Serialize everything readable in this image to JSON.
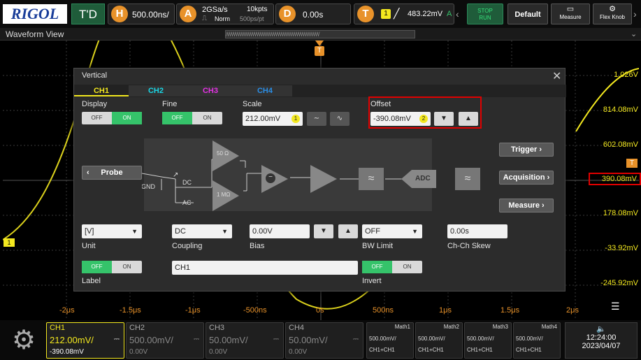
{
  "brand": "RIGOL",
  "top": {
    "mode": "T'D",
    "h_letter": "H",
    "h_value": "500.00ns/",
    "a_letter": "A",
    "sample_rate": "2GSa/s",
    "memory": "10kpts",
    "acq_mode": "Norm",
    "sample_interval": "500ps/pt",
    "d_letter": "D",
    "delay": "0.00s",
    "t_letter": "T",
    "trig_source": "1",
    "trig_level": "483.22mV",
    "trig_mode": "A",
    "stop_run": "STOP RUN",
    "stop_label": "STOP",
    "run_label": "RUN",
    "default_label": "Default",
    "measure_label": "Measure",
    "flexknob_label": "Flex Knob"
  },
  "waveform_title": "Waveform View",
  "y_labels": [
    "1.026V",
    "814.08mV",
    "602.08mV",
    "390.08mV",
    "178.08mV",
    "-33.92mV",
    "-245.92mV"
  ],
  "x_labels": [
    "-2μs",
    "-1.5μs",
    "-1μs",
    "-500ns",
    "0s",
    "500ns",
    "1μs",
    "1.5μs",
    "2μs"
  ],
  "markers": {
    "trigger_top": "T",
    "trigger_right": "T",
    "ch1": "1"
  },
  "dialog": {
    "title": "Vertical",
    "tabs": [
      "CH1",
      "CH2",
      "CH3",
      "CH4"
    ],
    "display_label": "Display",
    "fine_label": "Fine",
    "scale_label": "Scale",
    "scale_value": "212.00mV",
    "scale_badge": "1",
    "offset_label": "Offset",
    "offset_value": "-390.08mV",
    "offset_badge": "2",
    "off": "OFF",
    "on": "ON",
    "probe": "Probe",
    "gnd": "GND",
    "dc": "DC",
    "ac": "AC",
    "r50": "50 Ω",
    "r1m": "1 MΩ",
    "adc": "ADC",
    "nav": [
      "Trigger",
      "Acquisition",
      "Measure"
    ],
    "unit_value": "[V]",
    "unit_label": "Unit",
    "coupling_value": "DC",
    "coupling_label": "Coupling",
    "bias_value": "0.00V",
    "bias_label": "Bias",
    "bw_value": "OFF",
    "bw_label": "BW Limit",
    "skew_value": "0.00s",
    "skew_label": "Ch-Ch Skew",
    "label_label": "Label",
    "label_value": "CH1",
    "invert_label": "Invert"
  },
  "bottom": {
    "ch1": {
      "name": "CH1",
      "scale": "212.00mV/",
      "offset": "-390.08mV"
    },
    "ch2": {
      "name": "CH2",
      "scale": "500.00mV/",
      "offset": "0.00V"
    },
    "ch3": {
      "name": "CH3",
      "scale": "50.00mV/",
      "offset": "0.00V"
    },
    "ch4": {
      "name": "CH4",
      "scale": "50.00mV/",
      "offset": "0.00V"
    },
    "math": [
      {
        "name": "Math1",
        "scale": "500.00mV/",
        "expr": "CH1+CH1"
      },
      {
        "name": "Math2",
        "scale": "500.00mV/",
        "expr": "CH1+CH1"
      },
      {
        "name": "Math3",
        "scale": "500.00mV/",
        "expr": "CH1+CH1"
      },
      {
        "name": "Math4",
        "scale": "500.00mV/",
        "expr": "CH1+CH1"
      }
    ],
    "time": "12:24:00",
    "date": "2023/04/07"
  },
  "colors": {
    "ch1": "#f3e81f",
    "ch2": "#19d7e6",
    "ch3": "#e632e6",
    "ch4": "#2a8ee6",
    "accent": "#e8922a",
    "highlight": "#e00000"
  }
}
